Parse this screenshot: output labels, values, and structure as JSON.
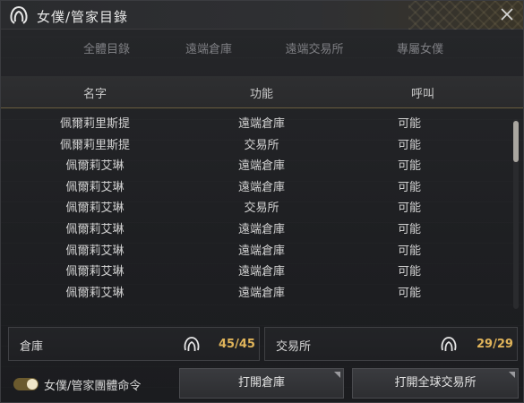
{
  "window": {
    "title": "女僕/管家目錄",
    "icons": {
      "title": "maid-hair-icon",
      "close": "close-icon"
    }
  },
  "tabs": [
    {
      "label": "全體目錄",
      "active": true
    },
    {
      "label": "遠端倉庫",
      "active": false
    },
    {
      "label": "遠端交易所",
      "active": false
    },
    {
      "label": "專屬女僕",
      "active": false
    }
  ],
  "columns": {
    "name": "名字",
    "function": "功能",
    "call": "呼叫"
  },
  "rows": [
    {
      "name": "佩爾莉里斯提",
      "function": "遠端倉庫",
      "call": "可能"
    },
    {
      "name": "佩爾莉里斯提",
      "function": "交易所",
      "call": "可能"
    },
    {
      "name": "佩爾莉艾琳",
      "function": "遠端倉庫",
      "call": "可能"
    },
    {
      "name": "佩爾莉艾琳",
      "function": "遠端倉庫",
      "call": "可能"
    },
    {
      "name": "佩爾莉艾琳",
      "function": "交易所",
      "call": "可能"
    },
    {
      "name": "佩爾莉艾琳",
      "function": "遠端倉庫",
      "call": "可能"
    },
    {
      "name": "佩爾莉艾琳",
      "function": "遠端倉庫",
      "call": "可能"
    },
    {
      "name": "佩爾莉艾琳",
      "function": "遠端倉庫",
      "call": "可能"
    },
    {
      "name": "佩爾莉艾琳",
      "function": "遠端倉庫",
      "call": "可能"
    }
  ],
  "scroll": {
    "position_fraction": 0.0,
    "visible_fraction": 0.22
  },
  "summary": {
    "warehouse": {
      "label": "倉庫",
      "count": "45/45",
      "icon": "maid-hair-icon"
    },
    "exchange": {
      "label": "交易所",
      "count": "29/29",
      "icon": "maid-hair-icon"
    }
  },
  "footer": {
    "toggle_label": "女僕/管家團體命令",
    "toggle_on": true,
    "open_warehouse": "打開倉庫",
    "open_global_exchange": "打開全球交易所"
  },
  "colors": {
    "accent": "#e0b45a",
    "background": "#1e1f22",
    "divider": "#6a5d3e"
  }
}
